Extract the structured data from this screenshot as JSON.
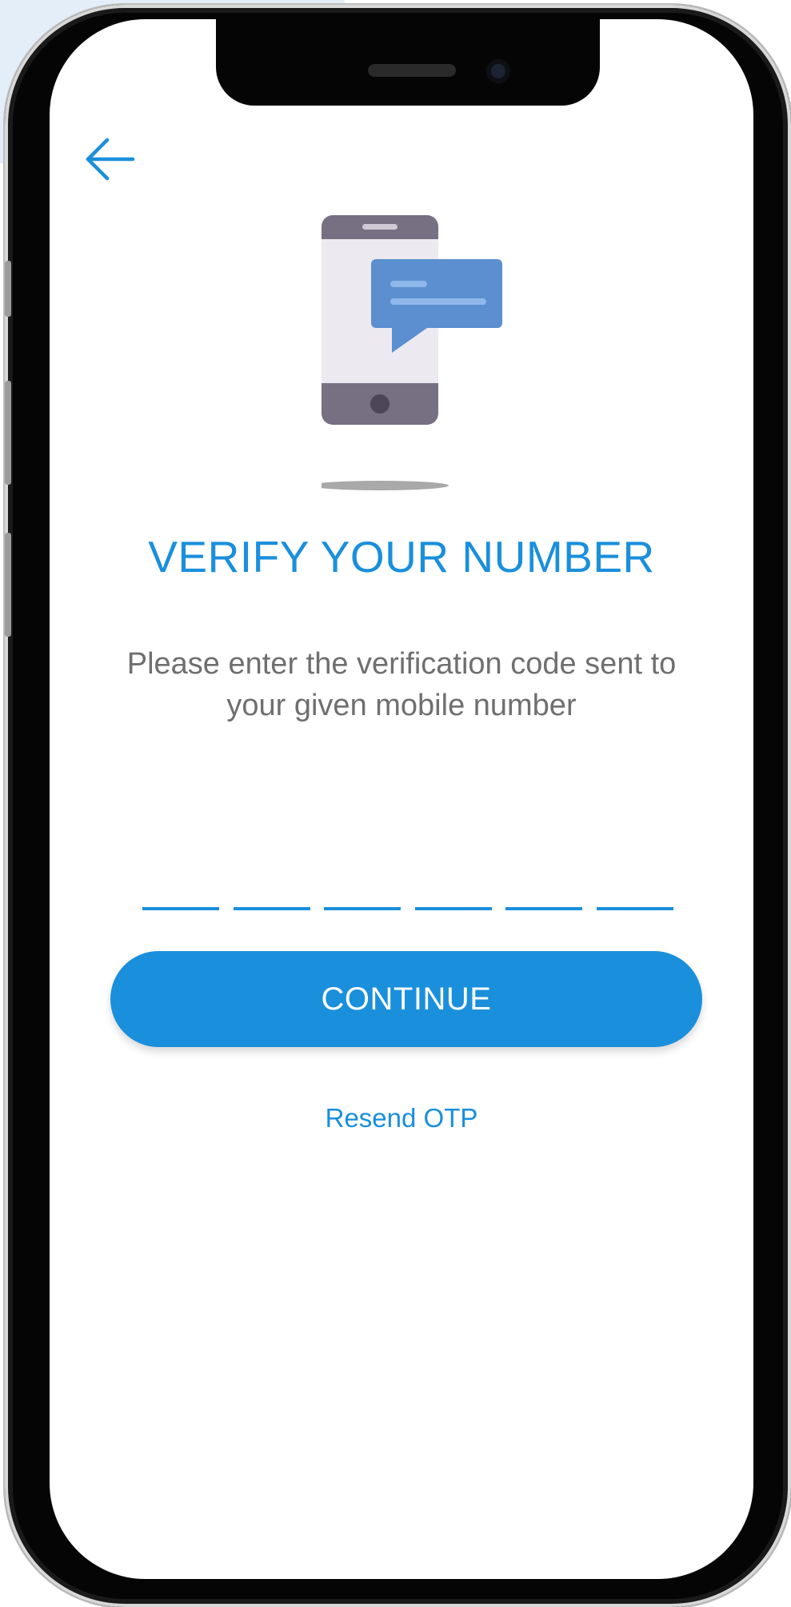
{
  "screen": {
    "title": "VERIFY YOUR NUMBER",
    "subtitle": "Please enter the verification code sent to your given mobile number",
    "otp": {
      "slots": [
        "",
        "",
        "",
        "",
        "",
        ""
      ]
    },
    "continue_label": "CONTINUE",
    "resend_label": "Resend OTP"
  },
  "icons": {
    "back": "arrow-left-icon",
    "illustration": "phone-message-illustration"
  },
  "colors": {
    "accent": "#1a8fdc",
    "subtitle_text": "#6f6f6f",
    "phone_body": "#eceaf0",
    "phone_frame": "#776f82",
    "bubble": "#5b8fd0"
  }
}
